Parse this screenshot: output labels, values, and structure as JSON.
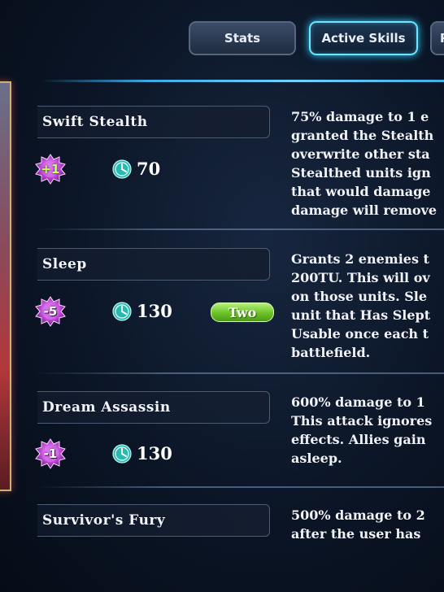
{
  "tabs": [
    {
      "label": "Stats",
      "active": false
    },
    {
      "label": "Active Skills",
      "active": true
    },
    {
      "label": "P",
      "active": false
    }
  ],
  "accent_color": "#6ee6ff",
  "skills": [
    {
      "name": "Swift Stealth",
      "badge": "+1",
      "badge_icon": "purple-gear-badge",
      "cost": "70",
      "target": null,
      "description_lines": [
        "75% damage to 1 e",
        "granted the Stealth",
        "overwrite other sta",
        "Stealthed units ign",
        "that would damage",
        "damage will remove"
      ]
    },
    {
      "name": "Sleep",
      "badge": "-5",
      "badge_icon": "purple-gear-badge",
      "cost": "130",
      "target": "Two",
      "description_lines": [
        "Grants 2 enemies t",
        "200TU. This will ov",
        "on those units. Sle",
        "unit that Has Slept",
        "Usable once each t",
        "battlefield."
      ]
    },
    {
      "name": "Dream Assassin",
      "badge": "-1",
      "badge_icon": "purple-gear-badge",
      "cost": "130",
      "target": null,
      "description_lines": [
        "600% damage to 1",
        "This attack ignores",
        "effects. Allies gain",
        "asleep."
      ]
    },
    {
      "name": "Survivor's Fury",
      "badge": null,
      "cost": null,
      "target": null,
      "description_lines": [
        "500% damage to 2",
        "after the user has"
      ]
    }
  ]
}
